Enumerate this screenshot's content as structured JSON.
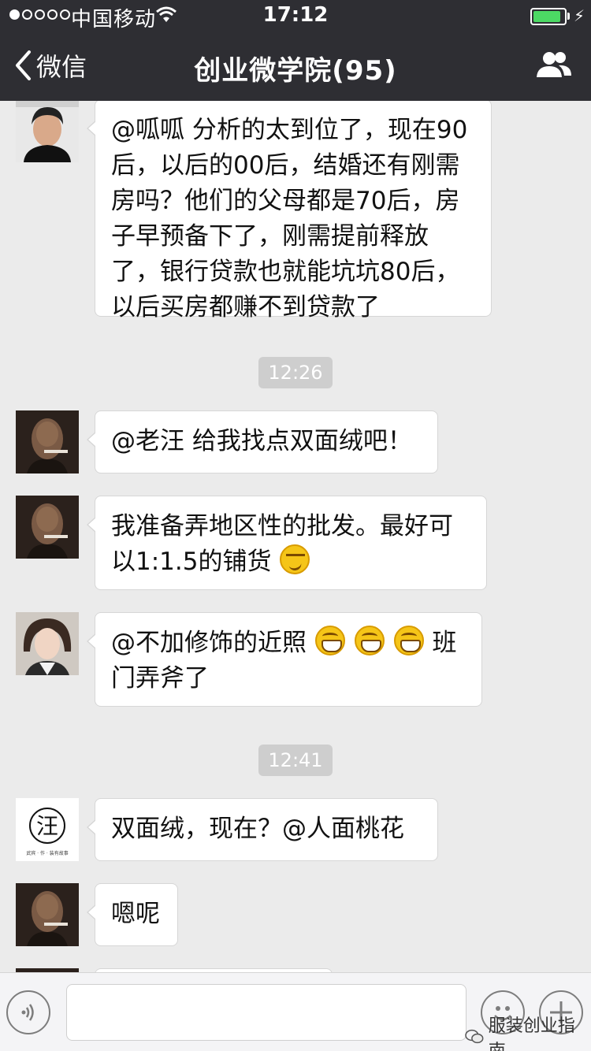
{
  "status_bar": {
    "carrier": "中国移动",
    "time": "17:12",
    "battery_level": 0.9
  },
  "nav": {
    "back_label": "微信",
    "title": "创业微学院(95)"
  },
  "messages": [
    {
      "text": "@呱呱 分析的太到位了，现在90后，以后的00后，结婚还有刚需房吗？他们的父母都是70后，房子早预备下了，刚需提前释放了，银行贷款也就能坑坑80后，以后买房都赚不到贷款了"
    },
    {
      "timestamp": "12:26"
    },
    {
      "text": "@老汪 给我找点双面绒吧！"
    },
    {
      "text": "我准备弄地区性的批发。最好可以1:1.5的铺货"
    },
    {
      "text_before": "@不加修饰的近照 ",
      "text_after": "班门弄斧了"
    },
    {
      "timestamp": "12:41"
    },
    {
      "text": "双面绒，现在？@人面桃花",
      "avatar_text": "汪",
      "avatar_caption": "武宾 · 作 · 装有故事"
    },
    {
      "text": "嗯呢"
    }
  ],
  "input_bar": {
    "value": "",
    "watermark": "服装创业指南"
  },
  "icons": {
    "back": "chevron-left-icon",
    "members": "group-icon",
    "voice": "voice-icon",
    "emoji": "emoji-icon",
    "plus": "plus-icon"
  },
  "colors": {
    "nav_bg": "#2e2e33",
    "chat_bg": "#ebebeb",
    "bubble_bg": "#ffffff",
    "battery": "#4cd964"
  }
}
